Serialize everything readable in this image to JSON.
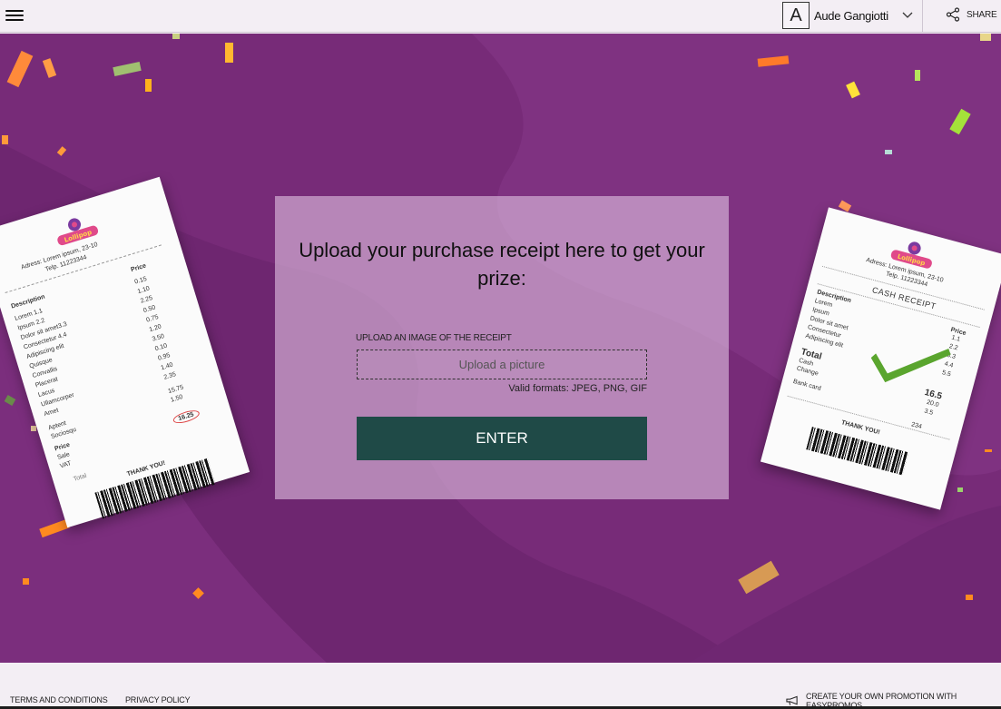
{
  "header": {
    "avatar_letter": "A",
    "user_name": "Aude Gangiotti",
    "share_label": "SHARE"
  },
  "hero": {
    "background_color": "#772b78",
    "receipt_left": {
      "address": "Adress: Lorem ipsum, 23-10",
      "phone": "Telp. 11223344",
      "col_description": "Description",
      "col_price": "Price",
      "items": [
        {
          "name": "Lorem  1.1",
          "price": "0.15"
        },
        {
          "name": "Ipsum  2.2",
          "price": "1.10"
        },
        {
          "name": "Dolor sit amet3.3",
          "price": "2.25"
        },
        {
          "name": "Consectetur  4.4",
          "price": "0.50"
        },
        {
          "name": "Adipiscing elit",
          "price": "0.75"
        },
        {
          "name": "Quisque",
          "price": "1.20"
        },
        {
          "name": "Convallis",
          "price": "3.50"
        },
        {
          "name": "Placerat",
          "price": "0.10"
        },
        {
          "name": "Lacus",
          "price": "0.95"
        },
        {
          "name": "Ullamcorper",
          "price": "1.40"
        },
        {
          "name": "Amet",
          "price": "2.35"
        }
      ],
      "subtotal_label": "Aptent",
      "subtotal_value": "15.75",
      "sociosqu_label": "Sociosqu",
      "sociosqu_value": "1.50",
      "price_label": "Price",
      "sale_label": "Sale",
      "vat_label": "VAT",
      "total_label": "Total",
      "total_value": "16.25",
      "thanks": "THANK YOU!"
    },
    "receipt_right": {
      "address": "Adress: Lorem ipsum, 23-10",
      "phone": "Telp. 11223344",
      "heading": "CASH RECEIPT",
      "col_description": "Description",
      "col_price": "Price",
      "items": [
        {
          "name": "Lorem",
          "price": "1.1"
        },
        {
          "name": "Ipsum",
          "price": "2.2"
        },
        {
          "name": "Dolor sit amet",
          "price": "3.3"
        },
        {
          "name": "Consectetur",
          "price": "4.4"
        },
        {
          "name": "Adipiscing elit",
          "price": "5.5"
        }
      ],
      "total_label": "Total",
      "total_value": "16.5",
      "cash_label": "Cash",
      "cash_value": "20.0",
      "change_label": "Change",
      "change_value": "3.5",
      "bank_label": "Bank card",
      "bank_value": "234",
      "thanks": "THANK YOU!"
    }
  },
  "form": {
    "title": "Upload your purchase receipt here to get your prize:",
    "upload_label": "UPLOAD AN IMAGE OF THE RECEIPT",
    "upload_placeholder": "Upload a picture",
    "valid_formats": "Valid formats: JPEG, PNG, GIF",
    "enter_label": "ENTER",
    "button_color": "#1f4a47"
  },
  "footer": {
    "terms": "TERMS AND CONDITIONS",
    "privacy": "PRIVACY POLICY",
    "promo": "CREATE YOUR OWN PROMOTION WITH EASYPROMOS"
  },
  "icons": {
    "menu": "hamburger-menu-icon",
    "chevron": "chevron-down-icon",
    "share": "share-icon",
    "megaphone": "megaphone-icon",
    "checkmark": "checkmark-icon"
  }
}
